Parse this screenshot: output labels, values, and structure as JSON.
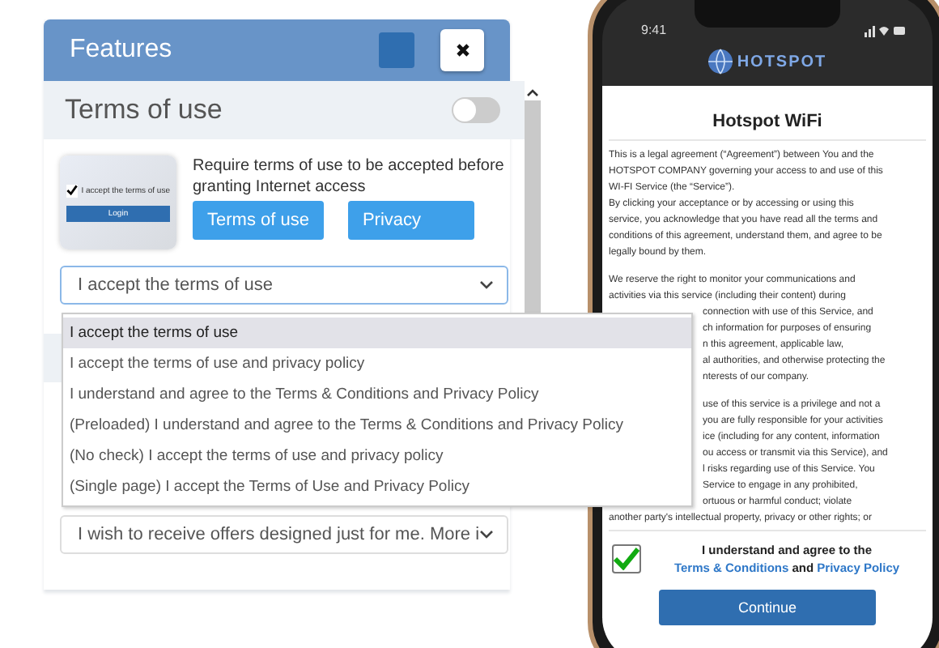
{
  "panel": {
    "title": "Features",
    "section": {
      "title": "Terms of use",
      "enabled": false
    },
    "preview": {
      "checked": true,
      "label": "I accept the terms of use",
      "button": "Login"
    },
    "description": "Require terms of use to be accepted before granting Internet access",
    "buttons": [
      "Terms of use",
      "Privacy"
    ],
    "select": {
      "value": "I accept the terms of use",
      "options": [
        {
          "label": "I accept the terms of use",
          "selected": true
        },
        {
          "label": "I accept the terms of use and privacy policy",
          "selected": false
        },
        {
          "label": "I understand and agree to the Terms & Conditions and Privacy Policy",
          "selected": false
        },
        {
          "label": "(Preloaded) I understand and agree to the Terms & Conditions and Privacy Policy",
          "selected": false
        },
        {
          "label": "(No check) I accept the terms of use and privacy policy",
          "selected": false
        },
        {
          "label": "(Single page) I accept the Terms of Use and Privacy Policy",
          "selected": false
        }
      ]
    },
    "offers_select": {
      "value": "I wish to receive offers designed just for me. More i"
    }
  },
  "phone": {
    "time": "9:41",
    "brand": "HOTSPOT",
    "title": "Hotspot WiFi",
    "paragraphs": [
      [
        {
          "text": "This is a legal agreement (“Agreement”) between You and the",
          "covered": false
        },
        {
          "text": "HOTSPOT COMPANY governing your access to and use of this",
          "covered": false
        },
        {
          "text": "WI-FI Service (the “Service”).",
          "covered": false
        },
        {
          "text": "By clicking your acceptance or by accessing or using this",
          "covered": false
        },
        {
          "text": "service, you acknowledge that you have read all the terms and",
          "covered": false
        },
        {
          "text": "conditions of this agreement, understand them, and agree to be",
          "covered": false
        },
        {
          "text": "legally bound by them.",
          "covered": false
        }
      ],
      [
        {
          "text": "We reserve the right to monitor your communications and",
          "covered": false
        },
        {
          "text": "activities via this service (including their content) during",
          "covered": false
        },
        {
          "text": "connection with use of this Service,  and",
          "covered": true
        },
        {
          "text": "ch information for purposes of ensuring",
          "covered": true
        },
        {
          "text": "n this agreement, applicable law,",
          "covered": true
        },
        {
          "text": "al authorities, and otherwise protecting the",
          "covered": true
        },
        {
          "text": "nterests of our company.",
          "covered": true
        }
      ],
      [
        {
          "text": "use of this service is a privilege and not a",
          "covered": true
        },
        {
          "text": "you are fully responsible for your activities",
          "covered": true
        },
        {
          "text": "ice (including for any content, information",
          "covered": true
        },
        {
          "text": "ou access or transmit via this Service), and",
          "covered": true
        },
        {
          "text": "l risks regarding use of this Service. You",
          "covered": true
        },
        {
          "text": "Service to engage in any prohibited,",
          "covered": true
        },
        {
          "text": "ortuous or harmful conduct; violate",
          "covered": true
        },
        {
          "text": "another party's intellectual property, privacy or other rights; or",
          "covered": false
        }
      ]
    ],
    "consent": {
      "checked": true,
      "before": "I understand and agree to the",
      "terms_link": "Terms & Conditions",
      "middle": "and",
      "privacy_link": "Privacy Policy"
    },
    "button": "Continue"
  }
}
